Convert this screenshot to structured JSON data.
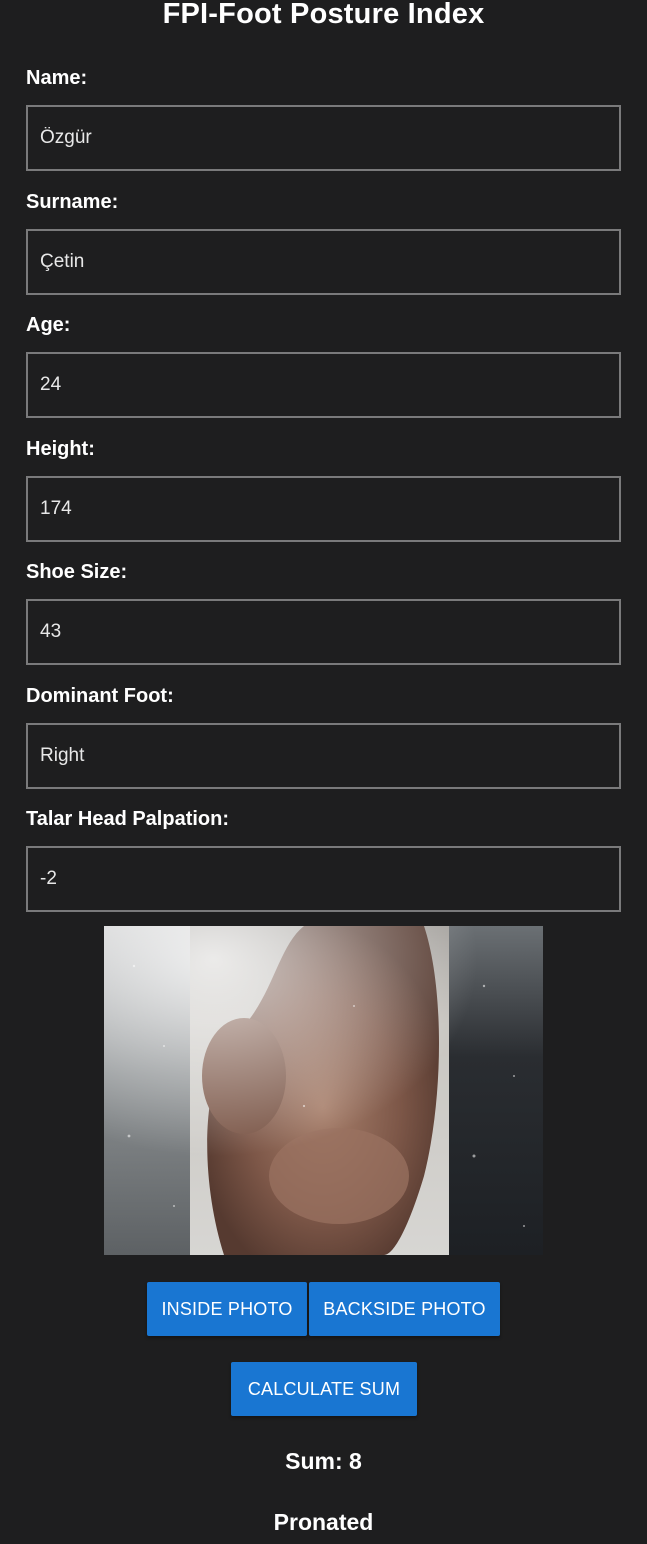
{
  "header": {
    "title": "FPI-Foot Posture Index"
  },
  "form": {
    "name_label": "Name:",
    "name_value": "Özgür",
    "surname_label": "Surname:",
    "surname_value": "Çetin",
    "age_label": "Age:",
    "age_value": "24",
    "height_label": "Height:",
    "height_value": "174",
    "shoe_size_label": "Shoe Size:",
    "shoe_size_value": "43",
    "dominant_foot_label": "Dominant Foot:",
    "dominant_foot_value": "Right",
    "talar_label": "Talar Head Palpation:",
    "talar_value": "-2"
  },
  "buttons": {
    "inside_photo": "INSIDE PHOTO",
    "backside_photo": "BACKSIDE PHOTO",
    "calculate_sum": "CALCULATE SUM"
  },
  "result": {
    "sum_text": "Sum: 8",
    "classification": "Pronated"
  },
  "colors": {
    "background": "#1e1e1f",
    "accent": "#1976d2",
    "input_border": "#7a7a7b"
  }
}
